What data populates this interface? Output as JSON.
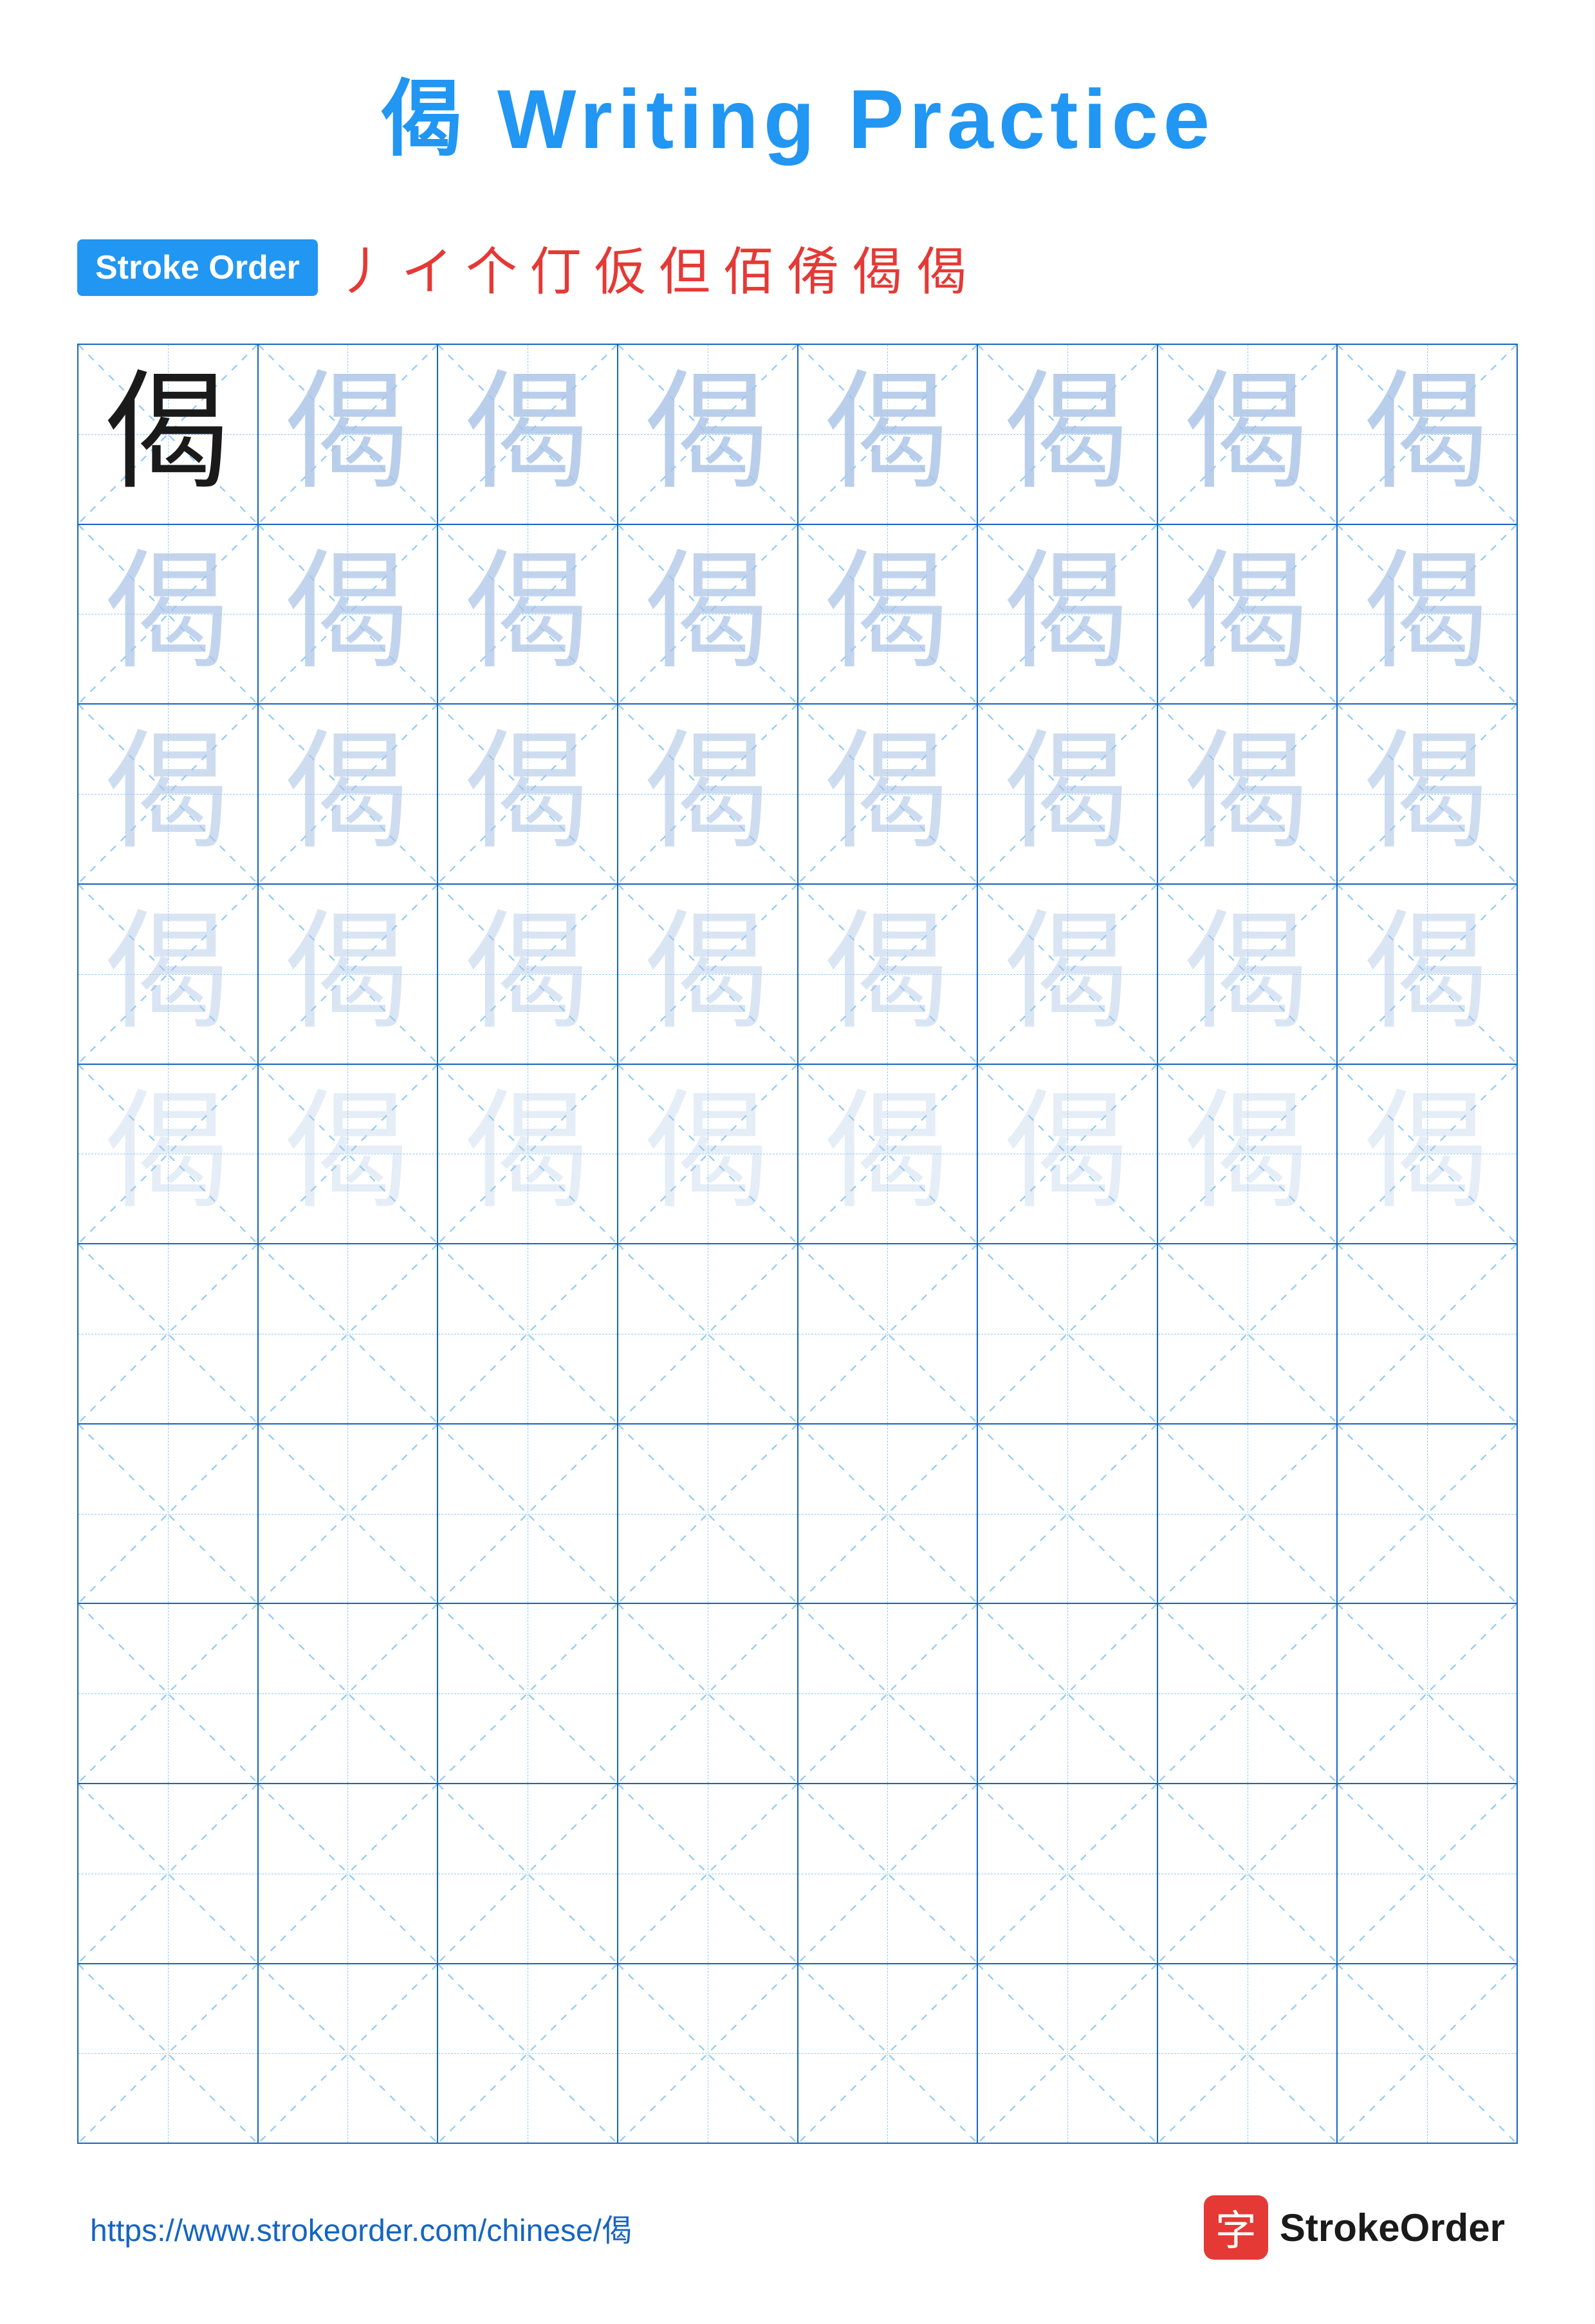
{
  "title": "偈 Writing Practice",
  "character": "偈",
  "stroke_order_badge": "Stroke Order",
  "stroke_sequence": [
    "丿",
    "イ",
    "个",
    "仃",
    "仮",
    "但",
    "佰",
    "倄",
    "偈",
    "偈"
  ],
  "grid": {
    "cols": 8,
    "rows": 10,
    "rows_with_char": 5,
    "ghost_opacity_levels": [
      1.0,
      0.75,
      0.6,
      0.45,
      0.3
    ]
  },
  "footer": {
    "url": "https://www.strokeorder.com/chinese/偈",
    "logo_char": "字",
    "logo_text": "StrokeOrder"
  }
}
